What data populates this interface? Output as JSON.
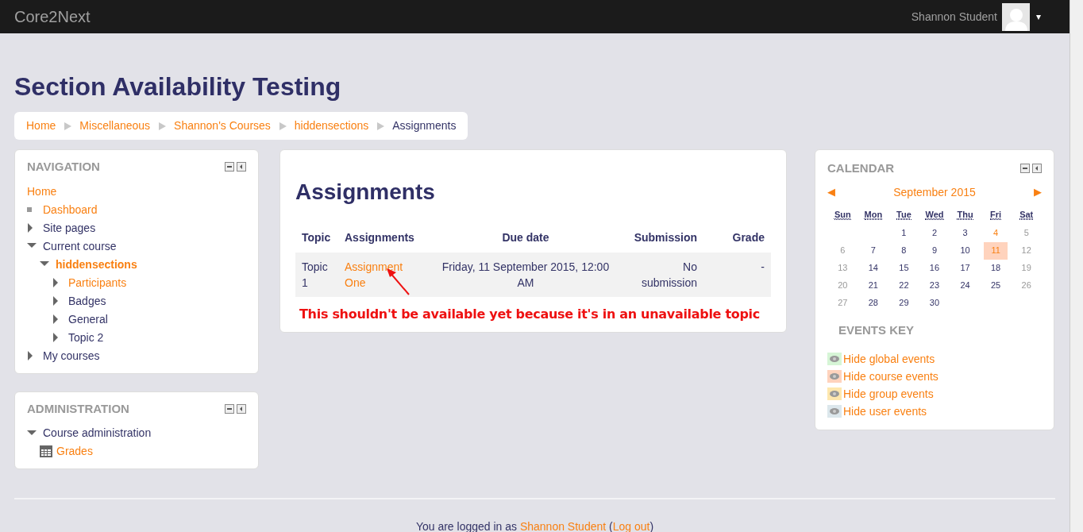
{
  "navbar": {
    "brand": "Core2Next",
    "user": "Shannon Student",
    "menu_caret": "▾"
  },
  "page_title": "Section Availability Testing",
  "breadcrumb": [
    {
      "label": "Home",
      "current": false
    },
    {
      "label": "Miscellaneous",
      "current": false
    },
    {
      "label": "Shannon's Courses",
      "current": false
    },
    {
      "label": "hiddensections",
      "current": false
    },
    {
      "label": "Assignments",
      "current": true
    }
  ],
  "navigation": {
    "title": "NAVIGATION",
    "items": [
      {
        "label": "Home",
        "kind": "plain",
        "link": true,
        "current": false
      },
      {
        "label": "Dashboard",
        "kind": "leaf",
        "link": true,
        "current": false
      },
      {
        "label": "Site pages",
        "kind": "branch",
        "expanded": false,
        "link": false,
        "current": false
      },
      {
        "label": "Current course",
        "kind": "branch",
        "expanded": true,
        "link": false,
        "current": false,
        "children": [
          {
            "label": "hiddensections",
            "kind": "branch",
            "expanded": true,
            "link": true,
            "current": true,
            "children": [
              {
                "label": "Participants",
                "kind": "branch",
                "expanded": false,
                "link": true,
                "current": false
              },
              {
                "label": "Badges",
                "kind": "branch",
                "expanded": false,
                "link": false,
                "current": false
              },
              {
                "label": "General",
                "kind": "branch",
                "expanded": false,
                "link": false,
                "current": false
              },
              {
                "label": "Topic 2",
                "kind": "branch",
                "expanded": false,
                "link": false,
                "current": false
              }
            ]
          }
        ]
      },
      {
        "label": "My courses",
        "kind": "branch",
        "expanded": false,
        "link": false,
        "current": false
      }
    ]
  },
  "administration": {
    "title": "ADMINISTRATION",
    "items": [
      {
        "label": "Course administration",
        "kind": "branch",
        "expanded": true,
        "link": false,
        "current": false,
        "children": [
          {
            "label": "Grades",
            "kind": "grid",
            "link": true,
            "current": false
          }
        ]
      }
    ]
  },
  "main": {
    "heading": "Assignments",
    "table": {
      "columns": [
        "Topic",
        "Assignments",
        "Due date",
        "Submission",
        "Grade"
      ],
      "rows": [
        {
          "topic": "Topic 1",
          "assignment": "Assignment One",
          "due": "Friday, 11 September 2015, 12:00 AM",
          "submission": "No submission",
          "grade": "-"
        }
      ]
    },
    "annotation": "This shouldn't be available yet because it's in an unavailable topic"
  },
  "calendar": {
    "title": "CALENDAR",
    "prev": "◀",
    "next": "▶",
    "month": "September 2015",
    "weekdays": [
      "Sun",
      "Mon",
      "Tue",
      "Wed",
      "Thu",
      "Fri",
      "Sat"
    ],
    "weeks": [
      [
        {
          "day": "1",
          "kind": "weekday"
        },
        {
          "day": "2",
          "kind": "weekday"
        },
        {
          "day": "3",
          "kind": "weekday"
        },
        {
          "day": "4",
          "kind": "event"
        },
        {
          "day": "5",
          "kind": "weekend"
        }
      ],
      [
        {
          "day": "6",
          "kind": "weekend"
        },
        {
          "day": "7",
          "kind": "weekday"
        },
        {
          "day": "8",
          "kind": "weekday"
        },
        {
          "day": "9",
          "kind": "weekday"
        },
        {
          "day": "10",
          "kind": "weekday"
        },
        {
          "day": "11",
          "kind": "today"
        },
        {
          "day": "12",
          "kind": "weekend"
        }
      ],
      [
        {
          "day": "13",
          "kind": "weekend"
        },
        {
          "day": "14",
          "kind": "weekday"
        },
        {
          "day": "15",
          "kind": "weekday"
        },
        {
          "day": "16",
          "kind": "weekday"
        },
        {
          "day": "17",
          "kind": "weekday"
        },
        {
          "day": "18",
          "kind": "weekday"
        },
        {
          "day": "19",
          "kind": "weekend"
        }
      ],
      [
        {
          "day": "20",
          "kind": "weekend"
        },
        {
          "day": "21",
          "kind": "weekday"
        },
        {
          "day": "22",
          "kind": "weekday"
        },
        {
          "day": "23",
          "kind": "weekday"
        },
        {
          "day": "24",
          "kind": "weekday"
        },
        {
          "day": "25",
          "kind": "weekday"
        },
        {
          "day": "26",
          "kind": "weekend"
        }
      ],
      [
        {
          "day": "27",
          "kind": "weekend"
        },
        {
          "day": "28",
          "kind": "weekday"
        },
        {
          "day": "29",
          "kind": "weekday"
        },
        {
          "day": "30",
          "kind": "weekday"
        }
      ]
    ],
    "events_key_title": "EVENTS KEY",
    "events_key": [
      {
        "label": "Hide global events",
        "color": "#d6f5d6"
      },
      {
        "label": "Hide course events",
        "color": "#ffd3bd"
      },
      {
        "label": "Hide group events",
        "color": "#fee7ae"
      },
      {
        "label": "Hide user events",
        "color": "#dce7ec"
      }
    ]
  },
  "footer": {
    "prefix": "You are logged in as",
    "user": "Shannon Student",
    "open_paren": "(",
    "logout": "Log out",
    "close_paren": ")"
  }
}
